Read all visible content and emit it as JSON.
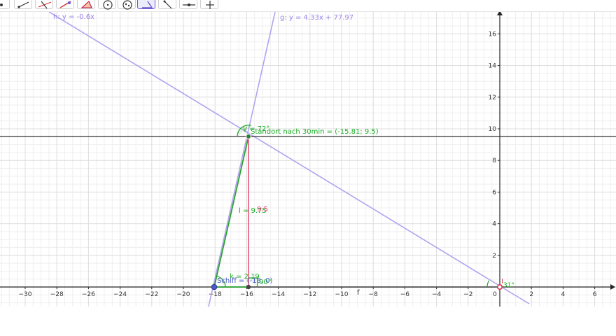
{
  "toolbar": {
    "tools": [
      {
        "name": "move-tool-icon",
        "active": false
      },
      {
        "name": "point-tool-icon",
        "active": false
      },
      {
        "name": "line-tool-icon",
        "active": false
      },
      {
        "name": "perpendicular-line-tool-icon",
        "active": false
      },
      {
        "name": "polygon-tool-icon",
        "active": false
      },
      {
        "name": "circle-tool-icon",
        "active": false
      },
      {
        "name": "ellipse-tool-icon",
        "active": false
      },
      {
        "name": "angle-tool-icon",
        "active": true
      },
      {
        "name": "reflect-tool-icon",
        "active": false
      },
      {
        "name": "slider-tool-icon",
        "active": false
      },
      {
        "name": "move-graphics-view-tool-icon",
        "active": false
      }
    ]
  },
  "graphics": {
    "x_ticks": [
      "−30",
      "−28",
      "−26",
      "−24",
      "−22",
      "−20",
      "−18",
      "−16",
      "−14",
      "−12",
      "−10",
      "−8",
      "−6",
      "−4",
      "−2",
      "0",
      "2",
      "4",
      "6"
    ],
    "y_ticks": [
      "2",
      "4",
      "6",
      "8",
      "10",
      "12",
      "14",
      "16"
    ],
    "line_h_label": "h: y = -0.6x",
    "line_g_label": "g: y = 4.33x + 77.97",
    "standort_label": "Standort nach 30min = (-15.81; 9.5)",
    "schiff_label": "Schiff = (-18, 0)",
    "segment_l_label": "l = 9.75",
    "height_label": "9.5",
    "segment_k_label": "k = 2.19",
    "segment_f_label": "f",
    "angle_gamma_label": "γ = 72°",
    "angle_right_label": "90°",
    "angle_origin_label": "31°",
    "point_origin_label": "I",
    "colors": {
      "grid_major": "#dcdcdc",
      "grid_minor": "#efefef",
      "axis": "#252525",
      "line_purple": "#b3a2f0",
      "label_purple": "#9b84e8",
      "segment_green": "#27a32f",
      "label_green": "#1aae23",
      "segment_pink": "#e8567a",
      "label_pink": "#e0305e",
      "point_blue": "#4a59c7",
      "point_red": "#d9344a",
      "horizontal_line": "#333333"
    }
  }
}
